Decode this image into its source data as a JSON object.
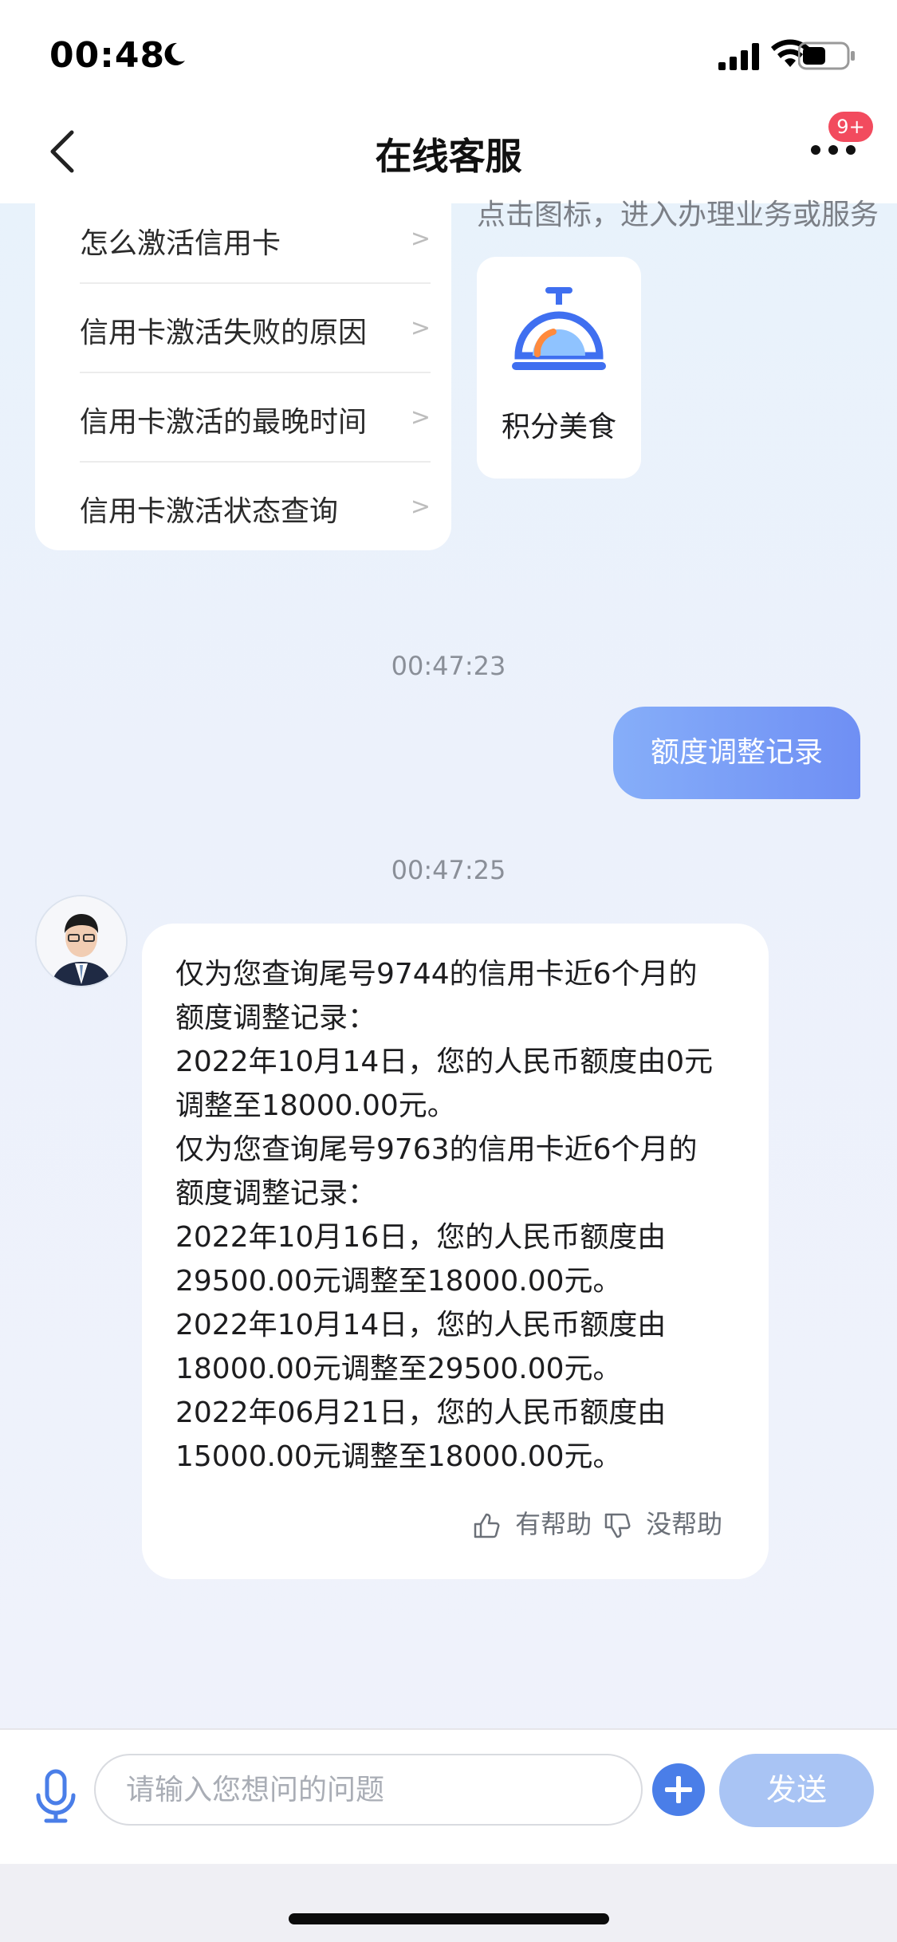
{
  "status_bar": {
    "time": "00:48"
  },
  "header": {
    "title": "在线客服",
    "badge": "9+"
  },
  "faq": {
    "items": [
      {
        "label": "怎么激活信用卡",
        "arrow": ">"
      },
      {
        "label": "信用卡激活失败的原因",
        "arrow": ">"
      },
      {
        "label": "信用卡激活的最晚时间",
        "arrow": ">"
      },
      {
        "label": "信用卡激活状态查询",
        "arrow": ">"
      }
    ]
  },
  "service": {
    "hint": "点击图标，进入办理业务或服务",
    "card_label": "积分美食"
  },
  "messages": {
    "ts1": "00:47:23",
    "user_msg": "额度调整记录",
    "ts2": "00:47:25",
    "bot_lines": [
      "仅为您查询尾号9744的信用卡近6个月的",
      "额度调整记录：",
      "2022年10月14日，您的人民币额度由0元",
      "调整至18000.00元。",
      "仅为您查询尾号9763的信用卡近6个月的",
      "额度调整记录：",
      "2022年10月16日，您的人民币额度由",
      "29500.00元调整至18000.00元。",
      "2022年10月14日，您的人民币额度由",
      "18000.00元调整至29500.00元。",
      "2022年06月21日，您的人民币额度由",
      "15000.00元调整至18000.00元。"
    ],
    "helpful": "有帮助",
    "not_helpful": "没帮助"
  },
  "input": {
    "placeholder": "请输入您想问的问题",
    "send": "发送"
  },
  "colors": {
    "accent": "#4a7ee8",
    "badge": "#f24b5e",
    "user_bubble": "#7b9ff6"
  }
}
